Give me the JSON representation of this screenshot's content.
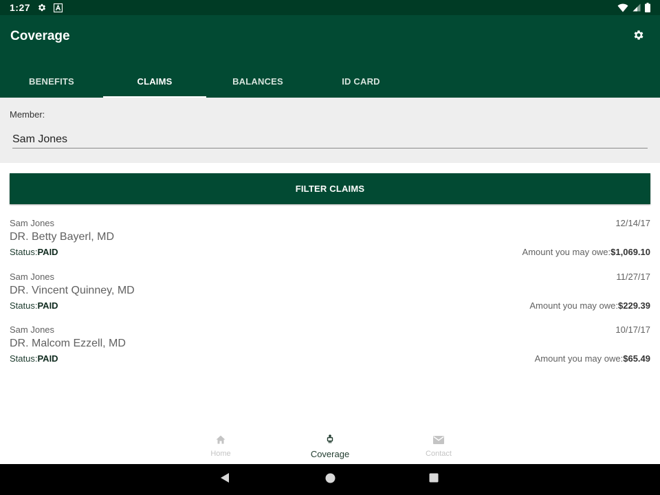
{
  "status_bar": {
    "time": "1:27",
    "icons": [
      "settings-icon",
      "a-icon",
      "wifi-icon",
      "signal-icon",
      "battery-icon"
    ]
  },
  "app_bar": {
    "title": "Coverage",
    "settings_icon": "gear-icon"
  },
  "tabs": [
    {
      "label": "BENEFITS",
      "active": false
    },
    {
      "label": "CLAIMS",
      "active": true
    },
    {
      "label": "BALANCES",
      "active": false
    },
    {
      "label": "ID CARD",
      "active": false
    }
  ],
  "member": {
    "label": "Member:",
    "value": "Sam Jones"
  },
  "filter": {
    "label": "FILTER CLAIMS"
  },
  "claims": [
    {
      "member": "Sam Jones",
      "date": "12/14/17",
      "provider": "DR. Betty Bayerl, MD",
      "status_label": "Status:",
      "status": "PAID",
      "owe_label": "Amount you may owe:",
      "owe": "$1,069.10"
    },
    {
      "member": "Sam Jones",
      "date": "11/27/17",
      "provider": "DR. Vincent Quinney, MD",
      "status_label": "Status:",
      "status": "PAID",
      "owe_label": "Amount you may owe:",
      "owe": "$229.39"
    },
    {
      "member": "Sam Jones",
      "date": "10/17/17",
      "provider": "DR. Malcom Ezzell, MD",
      "status_label": "Status:",
      "status": "PAID",
      "owe_label": "Amount you may owe:",
      "owe": "$65.49"
    }
  ],
  "bottom_nav": [
    {
      "label": "Home",
      "icon": "home-icon",
      "active": false
    },
    {
      "label": "Coverage",
      "icon": "coverage-icon",
      "active": true
    },
    {
      "label": "Contact",
      "icon": "mail-icon",
      "active": false
    }
  ],
  "colors": {
    "primary": "#024a33",
    "status_bar": "#003b25",
    "member_bg": "#eeeeee"
  }
}
